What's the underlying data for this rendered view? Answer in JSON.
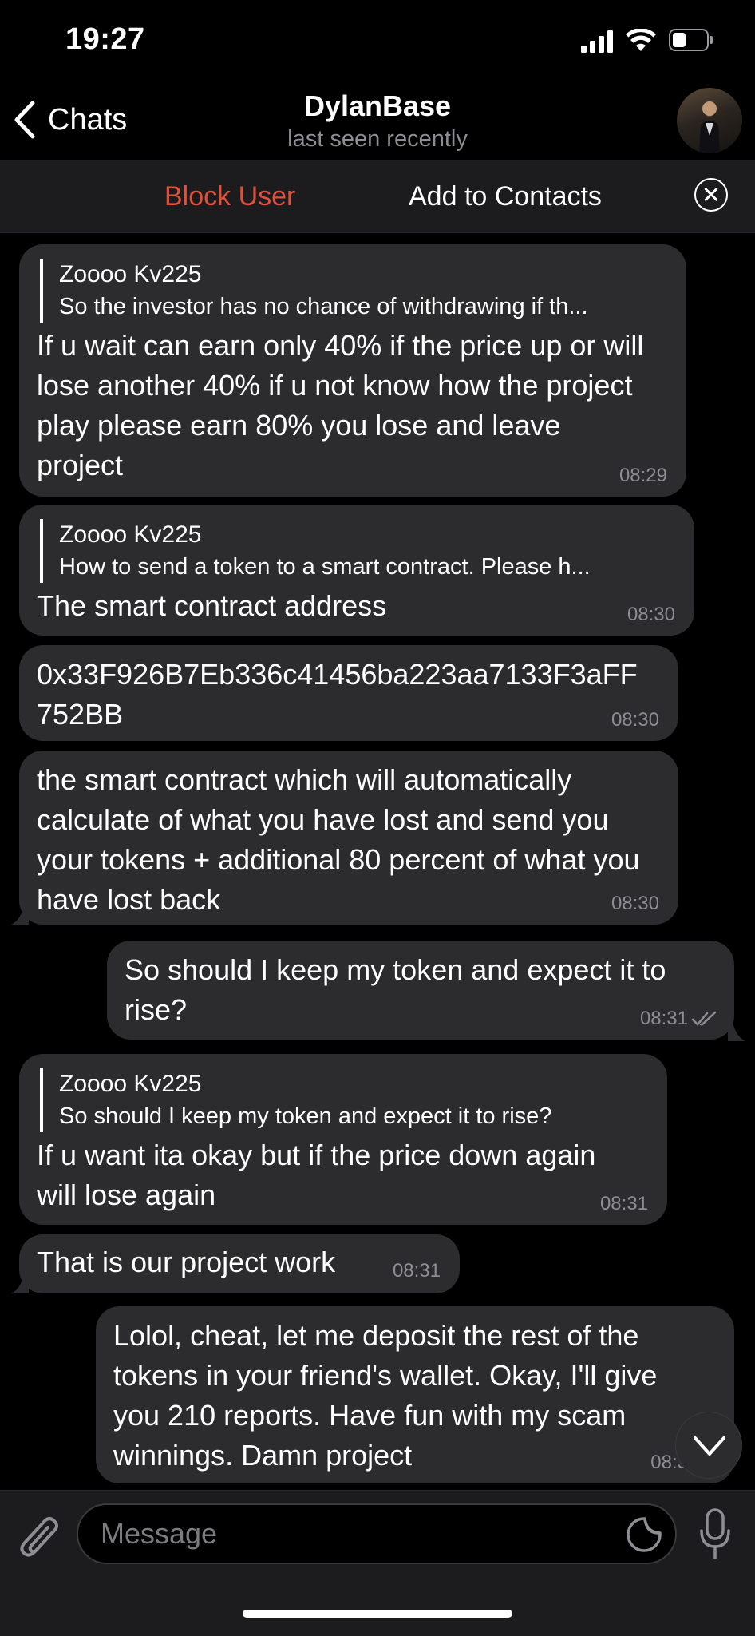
{
  "status_bar": {
    "time": "19:27"
  },
  "nav": {
    "back_label": "Chats",
    "title": "DylanBase",
    "subtitle": "last seen recently"
  },
  "action_bar": {
    "block_label": "Block User",
    "add_label": "Add to Contacts"
  },
  "messages": [
    {
      "direction": "incoming",
      "reply_name": "Zoooo Kv225",
      "reply_text": "So the investor has no chance of withdrawing if th...",
      "text": "If u wait can earn only 40% if the price up or will lose another 40% if u not know how the project play please earn 80% you lose and leave project",
      "time": "08:29"
    },
    {
      "direction": "incoming",
      "reply_name": "Zoooo Kv225",
      "reply_text": "How to send a token to a smart contract.  Please h...",
      "text": "The smart contract address",
      "time": "08:30"
    },
    {
      "direction": "incoming",
      "text": "0x33F926B7Eb336c41456ba223aa7133F3aFF752BB",
      "time": "08:30"
    },
    {
      "direction": "incoming",
      "text": "the smart contract which will automatically calculate of what you have lost and send you your tokens + additional 80 percent of what you have lost back",
      "time": "08:30"
    },
    {
      "direction": "outgoing",
      "text": "So should I keep my token and expect it to rise?",
      "time": "08:31",
      "read": true
    },
    {
      "direction": "incoming",
      "reply_name": "Zoooo Kv225",
      "reply_text": "So should I keep my token and expect it to rise?",
      "text": "If u want ita okay but if the price down again will lose again",
      "time": "08:31"
    },
    {
      "direction": "incoming",
      "text": "That is our project work",
      "time": "08:31"
    },
    {
      "direction": "outgoing",
      "text": "Lolol, cheat, let me deposit the rest of the tokens in your friend's wallet.  Okay, I'll give you 210 reports.  Have fun with my scam winnings.  Damn project",
      "time": "08:3"
    }
  ],
  "input": {
    "placeholder": "Message"
  },
  "colors": {
    "block_red": "#e0503c",
    "bubble": "#2c2c2e",
    "background": "#000000",
    "muted": "#8d8d93"
  }
}
